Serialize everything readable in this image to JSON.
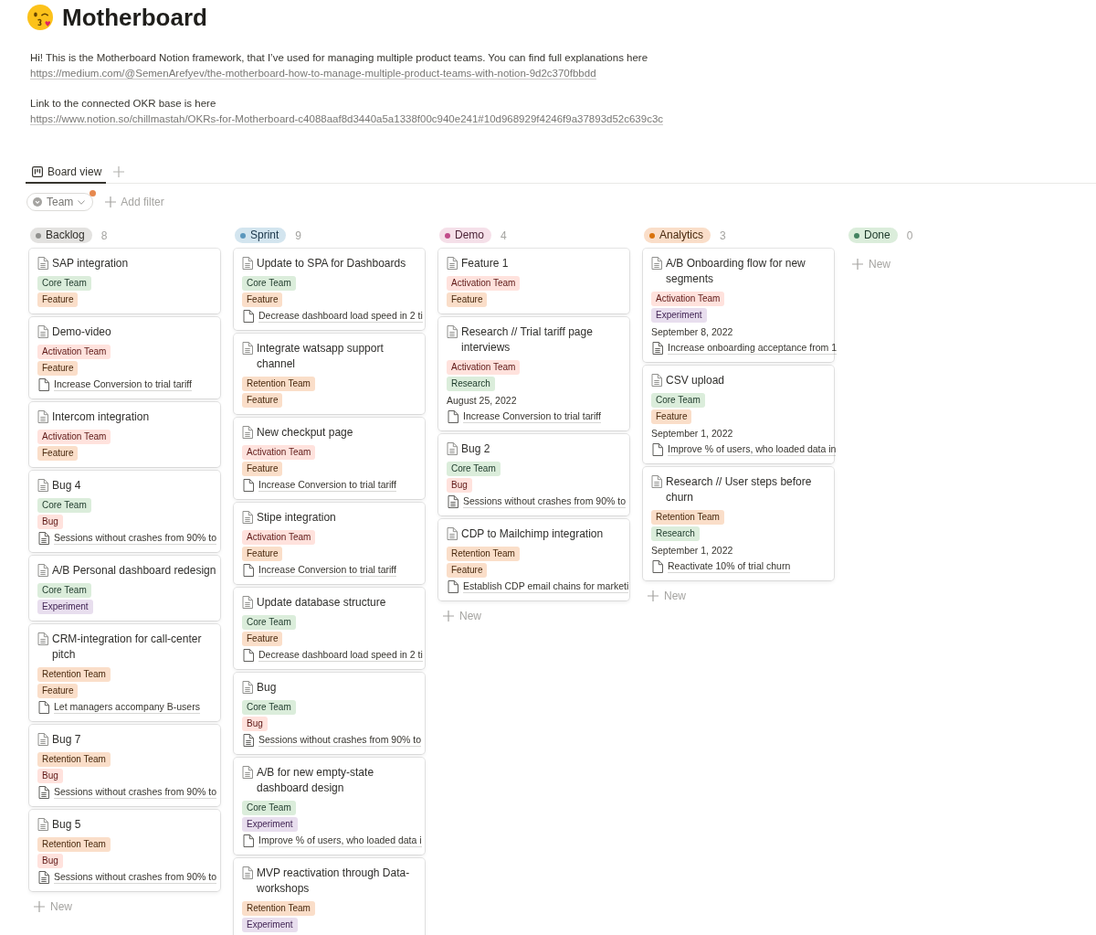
{
  "page": {
    "title": "Motherboard",
    "paragraphs": [
      {
        "text": "Hi! This is the Motherboard Notion framework, that I’ve used for managing multiple product teams. You can find full explanations here",
        "link": "https://medium.com/@SemenArefyev/the-motherboard-how-to-manage-multiple-product-teams-with-notion-9d2c370fbbdd"
      },
      {
        "text": "Link to the connected OKR base is here",
        "link": "https://www.notion.so/chillmastah/OKRs-for-Motherboard-c4088aaf8d3440a5a1338f00c940e241#10d968929f4246f9a37893d52c639c3c"
      }
    ]
  },
  "views": {
    "tabs": [
      {
        "label": "Board view",
        "selected": true
      }
    ]
  },
  "filters": {
    "chips": [
      {
        "label": "Team",
        "active": true
      }
    ],
    "add_filter": "Add filter"
  },
  "board": {
    "columns": [
      {
        "name": "Backlog",
        "color": "#91918e",
        "count": "8",
        "new_label": "New",
        "cards": [
          {
            "title": "SAP integration",
            "tags": [
              {
                "label": "Core Team",
                "color": "#dbeddb"
              },
              {
                "label": "Feature",
                "color": "#fadec9"
              }
            ]
          },
          {
            "title": "Demo-video",
            "tags": [
              {
                "label": "Activation Team",
                "color": "#ffe2dd"
              },
              {
                "label": "Feature",
                "color": "#fadec9"
              }
            ],
            "relation": {
              "text": "Increase Conversion to trial tariff",
              "kind": "blank"
            }
          },
          {
            "title": "Intercom integration",
            "tags": [
              {
                "label": "Activation Team",
                "color": "#ffe2dd"
              },
              {
                "label": "Feature",
                "color": "#fadec9"
              }
            ]
          },
          {
            "title": "Bug 4",
            "tags": [
              {
                "label": "Core Team",
                "color": "#dbeddb"
              },
              {
                "label": "Bug",
                "color": "#ffe2dd"
              }
            ],
            "relation": {
              "text": "Sessions without crashes from 90% to",
              "kind": "lined"
            }
          },
          {
            "title": "A/B Personal dashboard redesign",
            "tags": [
              {
                "label": "Core Team",
                "color": "#dbeddb"
              },
              {
                "label": "Experiment",
                "color": "#e8deee"
              }
            ]
          },
          {
            "title": "CRM-integration for call-center pitch",
            "tags": [
              {
                "label": "Retention Team",
                "color": "#fadec9"
              },
              {
                "label": "Feature",
                "color": "#fadec9"
              }
            ],
            "relation": {
              "text": "Let managers accompany B-users",
              "kind": "blank"
            }
          },
          {
            "title": "Bug 7",
            "tags": [
              {
                "label": "Retention Team",
                "color": "#fadec9"
              },
              {
                "label": "Bug",
                "color": "#ffe2dd"
              }
            ],
            "relation": {
              "text": "Sessions without crashes from 90% to",
              "kind": "lined"
            }
          },
          {
            "title": "Bug 5",
            "tags": [
              {
                "label": "Retention Team",
                "color": "#fadec9"
              },
              {
                "label": "Bug",
                "color": "#ffe2dd"
              }
            ],
            "relation": {
              "text": "Sessions without crashes from 90% to",
              "kind": "lined"
            }
          }
        ]
      },
      {
        "name": "Sprint",
        "color": "#5b97bd",
        "count": "9",
        "cards": [
          {
            "title": "Update to SPA for Dashboards",
            "tags": [
              {
                "label": "Core Team",
                "color": "#dbeddb"
              },
              {
                "label": "Feature",
                "color": "#fadec9"
              }
            ],
            "relation": {
              "text": "Decrease dashboard load speed in 2 ti",
              "kind": "blank"
            }
          },
          {
            "title": "Integrate watsapp support channel",
            "tags": [
              {
                "label": "Retention Team",
                "color": "#fadec9"
              },
              {
                "label": "Feature",
                "color": "#fadec9"
              }
            ]
          },
          {
            "title": "New checkput page",
            "tags": [
              {
                "label": "Activation Team",
                "color": "#ffe2dd"
              },
              {
                "label": "Feature",
                "color": "#fadec9"
              }
            ],
            "relation": {
              "text": "Increase Conversion to trial tariff",
              "kind": "blank"
            }
          },
          {
            "title": "Stipe integration",
            "tags": [
              {
                "label": "Activation Team",
                "color": "#ffe2dd"
              },
              {
                "label": "Feature",
                "color": "#fadec9"
              }
            ],
            "relation": {
              "text": "Increase Conversion to trial tariff",
              "kind": "blank"
            }
          },
          {
            "title": "Update database structure",
            "tags": [
              {
                "label": "Core Team",
                "color": "#dbeddb"
              },
              {
                "label": "Feature",
                "color": "#fadec9"
              }
            ],
            "relation": {
              "text": "Decrease dashboard load speed in 2 ti",
              "kind": "blank"
            }
          },
          {
            "title": "Bug",
            "tags": [
              {
                "label": "Core Team",
                "color": "#dbeddb"
              },
              {
                "label": "Bug",
                "color": "#ffe2dd"
              }
            ],
            "relation": {
              "text": "Sessions without crashes from 90% to",
              "kind": "lined"
            }
          },
          {
            "title": "A/B for new empty-state dashboard design",
            "tags": [
              {
                "label": "Core Team",
                "color": "#dbeddb"
              },
              {
                "label": "Experiment",
                "color": "#e8deee"
              }
            ],
            "relation": {
              "text": "Improve % of users, who loaded data i",
              "kind": "blank"
            }
          },
          {
            "title": "MVP reactivation through Data-workshops",
            "tags": [
              {
                "label": "Retention Team",
                "color": "#fadec9"
              },
              {
                "label": "Experiment",
                "color": "#e8deee"
              }
            ]
          }
        ]
      },
      {
        "name": "Demo",
        "color": "#c14c8a",
        "count": "4",
        "new_label": "New",
        "cards": [
          {
            "title": "Feature 1",
            "tags": [
              {
                "label": "Activation Team",
                "color": "#ffe2dd"
              },
              {
                "label": "Feature",
                "color": "#fadec9"
              }
            ]
          },
          {
            "title": "Research // Trial tariff page interviews",
            "tags": [
              {
                "label": "Activation Team",
                "color": "#ffe2dd"
              },
              {
                "label": "Research",
                "color": "#dbeddb"
              }
            ],
            "date": "August 25, 2022",
            "relation": {
              "text": "Increase Conversion to trial tariff",
              "kind": "blank"
            }
          },
          {
            "title": "Bug 2",
            "tags": [
              {
                "label": "Core Team",
                "color": "#dbeddb"
              },
              {
                "label": "Bug",
                "color": "#ffe2dd"
              }
            ],
            "relation": {
              "text": "Sessions without crashes from 90% to",
              "kind": "lined"
            }
          },
          {
            "title": "CDP to Mailchimp integration",
            "tags": [
              {
                "label": "Retention Team",
                "color": "#fadec9"
              },
              {
                "label": "Feature",
                "color": "#fadec9"
              }
            ],
            "relation": {
              "text": "Establish CDP email chains for marketi",
              "kind": "blank"
            }
          }
        ]
      },
      {
        "name": "Analytics",
        "color": "#d9730d",
        "count": "3",
        "new_label": "New",
        "cards": [
          {
            "title": "A/B Onboarding flow for new segments",
            "tags": [
              {
                "label": "Activation Team",
                "color": "#ffe2dd"
              },
              {
                "label": "Experiment",
                "color": "#e8deee"
              }
            ],
            "date": "September 8, 2022",
            "relation": {
              "text": "Increase onboarding acceptance from 1",
              "kind": "lined"
            }
          },
          {
            "title": "CSV upload",
            "tags": [
              {
                "label": "Core Team",
                "color": "#dbeddb"
              },
              {
                "label": "Feature",
                "color": "#fadec9"
              }
            ],
            "date": "September 1, 2022",
            "relation": {
              "text": "Improve % of users, who loaded data in",
              "kind": "blank"
            }
          },
          {
            "title": "Research // User steps before churn",
            "tags": [
              {
                "label": "Retention Team",
                "color": "#fadec9"
              },
              {
                "label": "Research",
                "color": "#dbeddb"
              }
            ],
            "date": "September 1, 2022",
            "relation": {
              "text": "Reactivate 10% of trial churn",
              "kind": "blank"
            }
          }
        ]
      },
      {
        "name": "Done",
        "color": "#448361",
        "count": "0",
        "new_label": "New"
      }
    ]
  }
}
